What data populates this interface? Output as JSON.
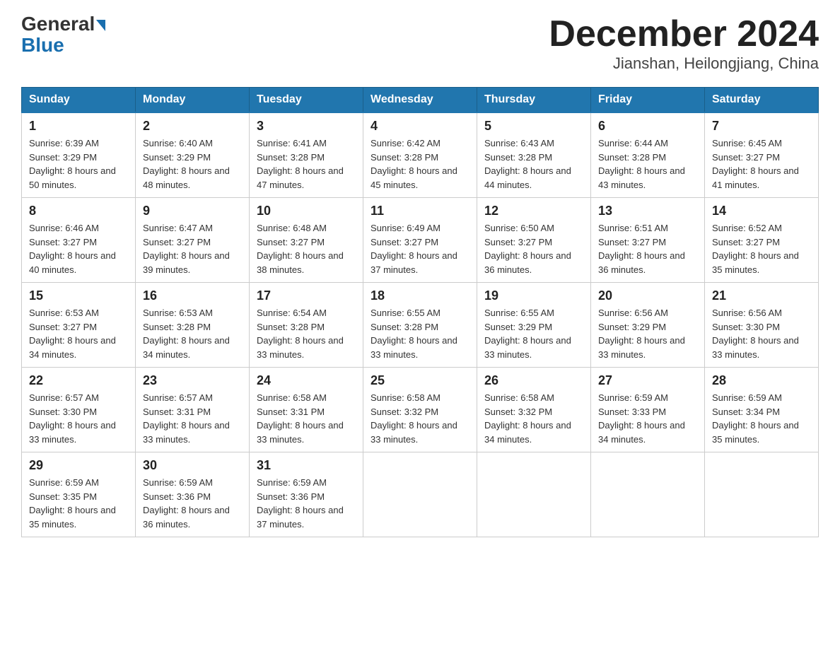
{
  "header": {
    "logo_line1": "General",
    "logo_line2": "Blue",
    "title": "December 2024",
    "subtitle": "Jianshan, Heilongjiang, China"
  },
  "weekdays": [
    "Sunday",
    "Monday",
    "Tuesday",
    "Wednesday",
    "Thursday",
    "Friday",
    "Saturday"
  ],
  "weeks": [
    [
      {
        "day": "1",
        "sunrise": "6:39 AM",
        "sunset": "3:29 PM",
        "daylight": "8 hours and 50 minutes."
      },
      {
        "day": "2",
        "sunrise": "6:40 AM",
        "sunset": "3:29 PM",
        "daylight": "8 hours and 48 minutes."
      },
      {
        "day": "3",
        "sunrise": "6:41 AM",
        "sunset": "3:28 PM",
        "daylight": "8 hours and 47 minutes."
      },
      {
        "day": "4",
        "sunrise": "6:42 AM",
        "sunset": "3:28 PM",
        "daylight": "8 hours and 45 minutes."
      },
      {
        "day": "5",
        "sunrise": "6:43 AM",
        "sunset": "3:28 PM",
        "daylight": "8 hours and 44 minutes."
      },
      {
        "day": "6",
        "sunrise": "6:44 AM",
        "sunset": "3:28 PM",
        "daylight": "8 hours and 43 minutes."
      },
      {
        "day": "7",
        "sunrise": "6:45 AM",
        "sunset": "3:27 PM",
        "daylight": "8 hours and 41 minutes."
      }
    ],
    [
      {
        "day": "8",
        "sunrise": "6:46 AM",
        "sunset": "3:27 PM",
        "daylight": "8 hours and 40 minutes."
      },
      {
        "day": "9",
        "sunrise": "6:47 AM",
        "sunset": "3:27 PM",
        "daylight": "8 hours and 39 minutes."
      },
      {
        "day": "10",
        "sunrise": "6:48 AM",
        "sunset": "3:27 PM",
        "daylight": "8 hours and 38 minutes."
      },
      {
        "day": "11",
        "sunrise": "6:49 AM",
        "sunset": "3:27 PM",
        "daylight": "8 hours and 37 minutes."
      },
      {
        "day": "12",
        "sunrise": "6:50 AM",
        "sunset": "3:27 PM",
        "daylight": "8 hours and 36 minutes."
      },
      {
        "day": "13",
        "sunrise": "6:51 AM",
        "sunset": "3:27 PM",
        "daylight": "8 hours and 36 minutes."
      },
      {
        "day": "14",
        "sunrise": "6:52 AM",
        "sunset": "3:27 PM",
        "daylight": "8 hours and 35 minutes."
      }
    ],
    [
      {
        "day": "15",
        "sunrise": "6:53 AM",
        "sunset": "3:27 PM",
        "daylight": "8 hours and 34 minutes."
      },
      {
        "day": "16",
        "sunrise": "6:53 AM",
        "sunset": "3:28 PM",
        "daylight": "8 hours and 34 minutes."
      },
      {
        "day": "17",
        "sunrise": "6:54 AM",
        "sunset": "3:28 PM",
        "daylight": "8 hours and 33 minutes."
      },
      {
        "day": "18",
        "sunrise": "6:55 AM",
        "sunset": "3:28 PM",
        "daylight": "8 hours and 33 minutes."
      },
      {
        "day": "19",
        "sunrise": "6:55 AM",
        "sunset": "3:29 PM",
        "daylight": "8 hours and 33 minutes."
      },
      {
        "day": "20",
        "sunrise": "6:56 AM",
        "sunset": "3:29 PM",
        "daylight": "8 hours and 33 minutes."
      },
      {
        "day": "21",
        "sunrise": "6:56 AM",
        "sunset": "3:30 PM",
        "daylight": "8 hours and 33 minutes."
      }
    ],
    [
      {
        "day": "22",
        "sunrise": "6:57 AM",
        "sunset": "3:30 PM",
        "daylight": "8 hours and 33 minutes."
      },
      {
        "day": "23",
        "sunrise": "6:57 AM",
        "sunset": "3:31 PM",
        "daylight": "8 hours and 33 minutes."
      },
      {
        "day": "24",
        "sunrise": "6:58 AM",
        "sunset": "3:31 PM",
        "daylight": "8 hours and 33 minutes."
      },
      {
        "day": "25",
        "sunrise": "6:58 AM",
        "sunset": "3:32 PM",
        "daylight": "8 hours and 33 minutes."
      },
      {
        "day": "26",
        "sunrise": "6:58 AM",
        "sunset": "3:32 PM",
        "daylight": "8 hours and 34 minutes."
      },
      {
        "day": "27",
        "sunrise": "6:59 AM",
        "sunset": "3:33 PM",
        "daylight": "8 hours and 34 minutes."
      },
      {
        "day": "28",
        "sunrise": "6:59 AM",
        "sunset": "3:34 PM",
        "daylight": "8 hours and 35 minutes."
      }
    ],
    [
      {
        "day": "29",
        "sunrise": "6:59 AM",
        "sunset": "3:35 PM",
        "daylight": "8 hours and 35 minutes."
      },
      {
        "day": "30",
        "sunrise": "6:59 AM",
        "sunset": "3:36 PM",
        "daylight": "8 hours and 36 minutes."
      },
      {
        "day": "31",
        "sunrise": "6:59 AM",
        "sunset": "3:36 PM",
        "daylight": "8 hours and 37 minutes."
      },
      null,
      null,
      null,
      null
    ]
  ]
}
